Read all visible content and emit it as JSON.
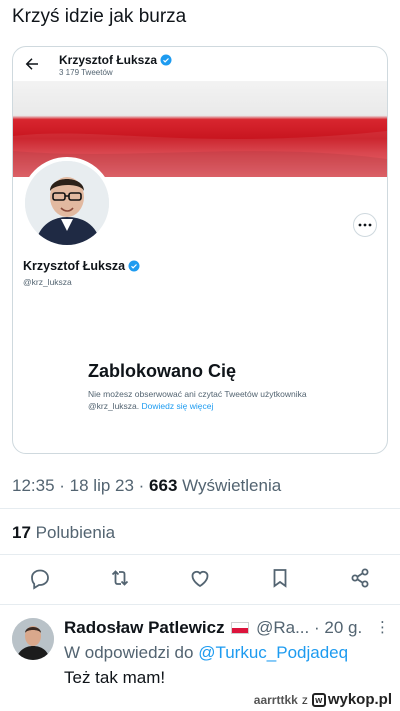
{
  "post": {
    "text": "Krzyś idzie jak burza"
  },
  "profile_card": {
    "header_name": "Krzysztof Łuksza",
    "header_tweet_count": "3 179 Tweetów",
    "name": "Krzysztof Łuksza",
    "handle": "@krz_luksza",
    "blocked_title": "Zablokowano Cię",
    "blocked_desc": "Nie możesz obserwować ani czytać Tweetów użytkownika @krz_luksza.",
    "blocked_link": "Dowiedz się więcej"
  },
  "tweet_meta": {
    "time": "12:35",
    "date": "18 lip 23",
    "views_count": "663",
    "views_label": "Wyświetlenia",
    "likes_count": "17",
    "likes_label": "Polubienia"
  },
  "reply": {
    "name": "Radosław Patlewicz",
    "handle": "@Ra...",
    "time": "20 g.",
    "reply_to_prefix": "W odpowiedzi do",
    "reply_to_mention": "@Turkuc_Podjadeq",
    "text": "Też tak mam!"
  },
  "watermark": {
    "user": "aarrttkk",
    "sep": "z",
    "site": "wykop.pl"
  },
  "colors": {
    "link": "#1d9bf0",
    "muted": "#536471",
    "text": "#0f1419",
    "flag_red": "#dc143c"
  },
  "icons": [
    "back-arrow-icon",
    "verified-badge-icon",
    "more-icon",
    "reply-icon",
    "retweet-icon",
    "like-icon",
    "bookmark-icon",
    "share-icon"
  ]
}
